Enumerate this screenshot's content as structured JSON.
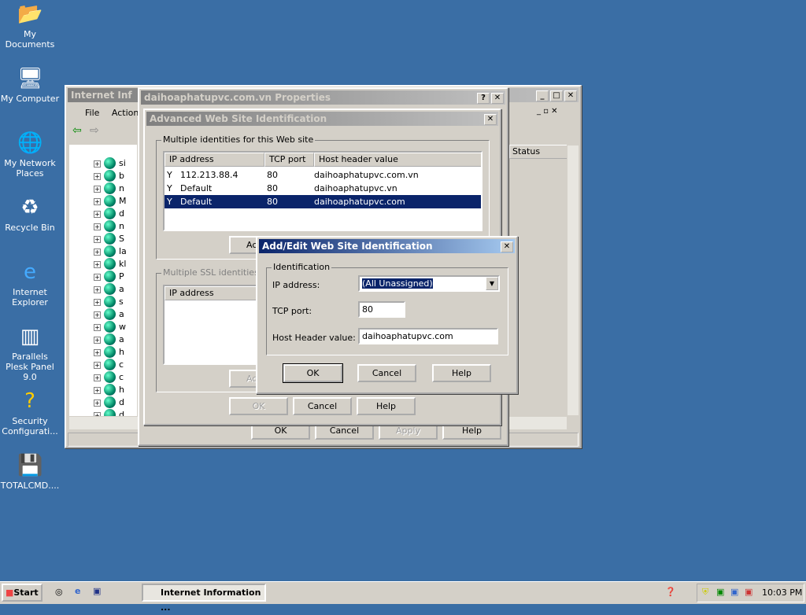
{
  "desktop": {
    "icons": [
      {
        "label": "My Documents",
        "icon": "folder-icon"
      },
      {
        "label": "My Computer",
        "icon": "computer-icon"
      },
      {
        "label": "My Network Places",
        "icon": "network-icon"
      },
      {
        "label": "Recycle Bin",
        "icon": "recycle-bin-icon"
      },
      {
        "label": "Internet Explorer",
        "icon": "ie-icon"
      },
      {
        "label": "Parallels Plesk Panel 9.0",
        "icon": "plesk-icon"
      },
      {
        "label": "Security Configurati...",
        "icon": "security-icon"
      },
      {
        "label": "TOTALCMD....",
        "icon": "floppy-icon"
      }
    ]
  },
  "iis": {
    "title": "Internet Information Services (IIS) Manager",
    "title_visible": "Internet Inf",
    "menu": {
      "file": "File",
      "action": "Action"
    },
    "status_col": "Status",
    "tree_items": [
      "si",
      "b",
      "n",
      "M",
      "d",
      "n",
      "S",
      "la",
      "kl",
      "P",
      "a",
      "s",
      "a",
      "w",
      "a",
      "h",
      "c",
      "c",
      "h",
      "d",
      "d"
    ]
  },
  "props": {
    "title": "daihoaphatupvc.com.vn Properties",
    "ok": "OK",
    "cancel": "Cancel",
    "apply": "Apply",
    "help": "Help"
  },
  "advanced": {
    "title": "Advanced Web Site Identification",
    "group1": "Multiple identities for this Web site",
    "columns": [
      "IP address",
      "TCP port",
      "Host header value"
    ],
    "rows": [
      {
        "ip": "112.213.88.4",
        "port": "80",
        "host": "daihoaphatupvc.com.vn",
        "selected": false
      },
      {
        "ip": "Default",
        "port": "80",
        "host": "daihoaphatupvc.vn",
        "selected": false
      },
      {
        "ip": "Default",
        "port": "80",
        "host": "daihoaphatupvc.com",
        "selected": true
      }
    ],
    "add1": "Ac",
    "group2": "Multiple SSL identities for",
    "ssl_col": "IP address",
    "add2": "Ac",
    "ok": "OK",
    "cancel": "Cancel",
    "help": "Help"
  },
  "addedit": {
    "title": "Add/Edit Web Site Identification",
    "group": "Identification",
    "ip_label": "IP address:",
    "ip_value": "(All Unassigned)",
    "port_label": "TCP port:",
    "port_value": "80",
    "host_label": "Host Header value:",
    "host_value": "daihoaphatupvc.com",
    "ok": "OK",
    "cancel": "Cancel",
    "help": "Help"
  },
  "taskbar": {
    "start": "Start",
    "task": "Internet Information ...",
    "clock": "10:03 PM"
  },
  "colors": {
    "desktop": "#3a6ea5",
    "active_title": "#0a246a",
    "selection": "#0a246a"
  }
}
